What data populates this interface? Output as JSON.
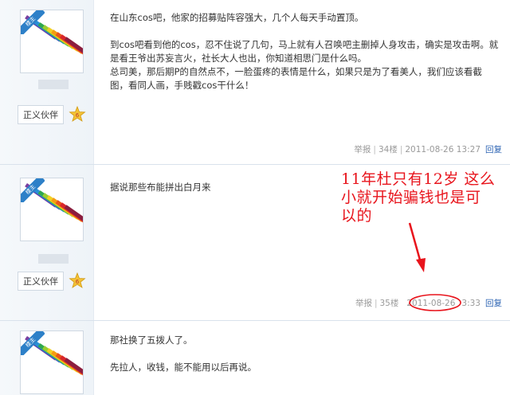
{
  "posts": [
    {
      "badge": "楼主",
      "rank": "正义伙伴",
      "rank_level": "6",
      "paragraphs": [
        "在山东cos吧，他家的招募贴阵容强大，几个人每天手动置顶。",
        "到cos吧看到他的cos，忍不住说了几句，马上就有人召唤吧主删掉人身攻击，确实是攻击啊。就是看王爷出苏妄言火，社长大人也出，你知道相思门是什么吗。",
        "总司美，那后期P的自然点不，一脸蛋疼的表情是什么，如果只是为了看美人，我们应该看截图，看同人画，手贱戳cos干什么！"
      ],
      "footer": {
        "report": "举报",
        "floor": "34楼",
        "time": "2011-08-26 13:27",
        "reply": "回复"
      }
    },
    {
      "badge": "楼主",
      "rank": "正义伙伴",
      "rank_level": "6",
      "paragraphs": [
        "据说那些布能拼出白月来"
      ],
      "footer": {
        "report": "举报",
        "floor": "35楼",
        "date": "2011-08-26",
        "clock": "3:33",
        "reply": "回复"
      }
    },
    {
      "badge": "楼主",
      "paragraphs": [
        "那社换了五拨人了。",
        "先拉人，收钱，能不能用以后再说。"
      ]
    }
  ],
  "annotation": {
    "text_line1": "11年杜只有12岁  这么",
    "text_line2": "小就开始骗钱也是可",
    "text_line3": "以的",
    "color": "#e8141c"
  },
  "icons": {
    "avatar": "colored-pencils-image",
    "medal": "star-medal-icon"
  },
  "colors": {
    "badge": "#2d80c8",
    "link": "#2d64b3"
  }
}
